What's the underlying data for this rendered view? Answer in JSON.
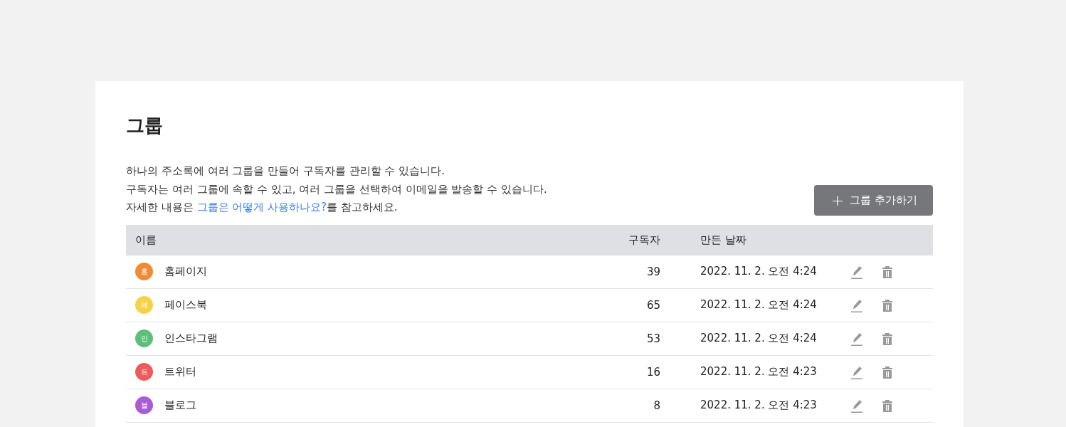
{
  "title": "그룹",
  "description": {
    "lines": [
      "하나의 주소록에 여러 그룹을 만들어 구독자를 관리할 수 있습니다.",
      "구독자는 여러 그룹에 속할 수 있고, 여러 그룹을 선택하여 이메일을 발송할 수 있습니다."
    ],
    "last_line": {
      "before": "자세한 내용은 ",
      "link": "그룹은 어떻게 사용하나요?",
      "after": "를 참고하세요."
    }
  },
  "add_button": {
    "icon": "+",
    "label": "그룹 추가하기"
  },
  "table": {
    "columns": [
      "이름",
      "구독자",
      "만든 날짜"
    ],
    "rows": [
      {
        "avatar": "홈",
        "color": "#f08a35",
        "name": "홈페이지",
        "subscribers": "39",
        "created": "2022. 11. 2. 오전 4:24"
      },
      {
        "avatar": "페",
        "color": "#f7d246",
        "name": "페이스북",
        "subscribers": "65",
        "created": "2022. 11. 2. 오전 4:24"
      },
      {
        "avatar": "인",
        "color": "#5dbf7a",
        "name": "인스타그램",
        "subscribers": "53",
        "created": "2022. 11. 2. 오전 4:24"
      },
      {
        "avatar": "트",
        "color": "#ec5c5c",
        "name": "트위터",
        "subscribers": "16",
        "created": "2022. 11. 2. 오전 4:23"
      },
      {
        "avatar": "블",
        "color": "#a95bd6",
        "name": "블로그",
        "subscribers": "8",
        "created": "2022. 11. 2. 오전 4:23"
      }
    ]
  }
}
